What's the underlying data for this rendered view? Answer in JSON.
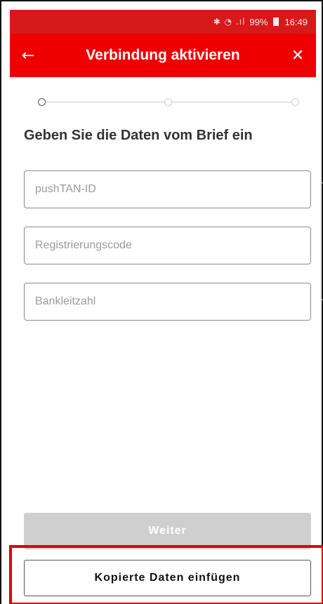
{
  "status_bar": {
    "icons": "✱ ◔ .ıl",
    "battery": "99%",
    "time": "16:49"
  },
  "app_bar": {
    "back_icon": "←",
    "title": "Verbindung aktivieren",
    "close_icon": "✕"
  },
  "stepper": {
    "total_steps": 3,
    "current_step": 1
  },
  "form": {
    "heading": "Geben Sie die Daten vom Brief ein",
    "fields": [
      {
        "placeholder": "pushTAN-ID",
        "value": ""
      },
      {
        "placeholder": "Registrierungscode",
        "value": ""
      },
      {
        "placeholder": "Bankleitzahl",
        "value": ""
      }
    ]
  },
  "buttons": {
    "next_label": "Weiter",
    "next_enabled": false,
    "paste_label": "Kopierte Daten einfügen"
  },
  "colors": {
    "brand_red": "#ee0000",
    "status_red": "#d8191c",
    "highlight_red": "#e10000",
    "disabled_gray": "#cfcfcf"
  }
}
